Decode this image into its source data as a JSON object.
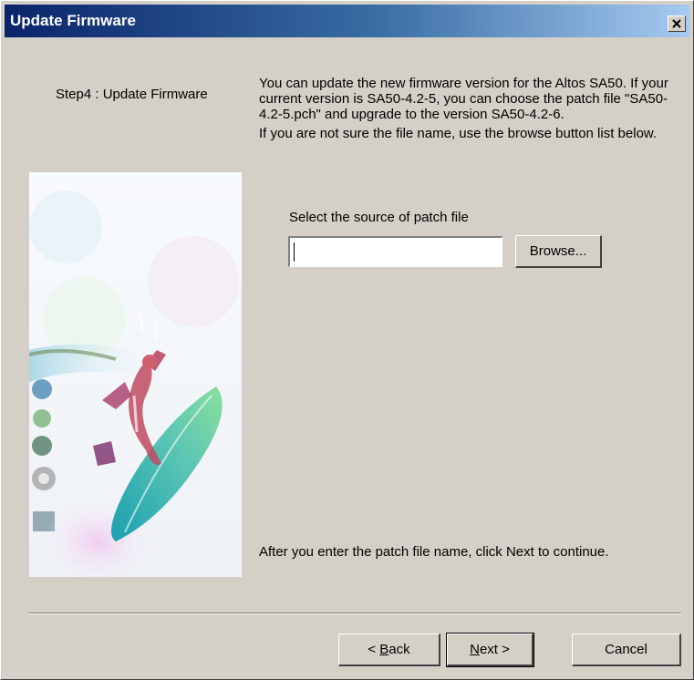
{
  "window": {
    "title": "Update Firmware",
    "close_icon": "close-icon"
  },
  "sidebar": {
    "step_label": "Step4 : Update Firmware",
    "art_icon": "surfer-illustration"
  },
  "content": {
    "paragraph1": "You can update the new firmware version for the Altos SA50. If your current version is SA50-4.2-5, you can choose the patch file \"SA50-4.2-5.pch\" and upgrade to the version SA50-4.2-6.",
    "paragraph2": "If you are not sure the file name, use the browse button list below.",
    "select_label": "Select the source of patch file",
    "patch_file_value": "",
    "browse_label": "Browse...",
    "footer_hint": "After you enter the patch file name, click Next to continue."
  },
  "buttons": {
    "back_prefix": "< ",
    "back_mnemonic": "B",
    "back_rest": "ack",
    "next_mnemonic": "N",
    "next_rest": "ext >",
    "cancel": "Cancel"
  },
  "colors": {
    "titlebar_start": "#0a246a",
    "titlebar_end": "#a6caf0",
    "dialog_face": "#d4d0c8"
  }
}
